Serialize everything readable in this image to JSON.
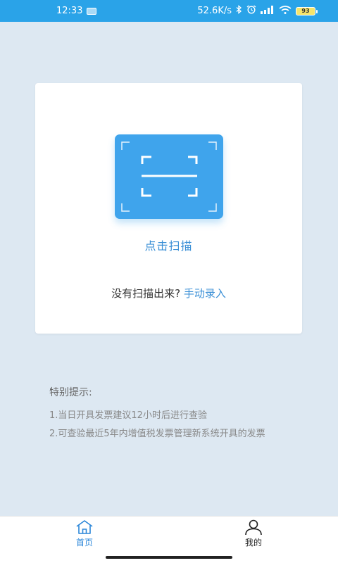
{
  "status_bar": {
    "time": "12:33",
    "network_speed": "52.6K/s",
    "battery_level": "93",
    "icons": [
      "notification-icon",
      "bluetooth-icon",
      "alarm-icon",
      "signal-icon",
      "wifi-icon",
      "battery-icon"
    ]
  },
  "scan_card": {
    "scan_label": "点击扫描",
    "manual_prompt": "没有扫描出来?",
    "manual_link": "手动录入",
    "scan_icon": "scan-frame-icon"
  },
  "tips": {
    "title": "特别提示:",
    "items": [
      "1.当日开具发票建议12小时后进行查验",
      "2.可查验最近5年内增值税发票管理新系统开具的发票"
    ]
  },
  "bottom_nav": {
    "items": [
      {
        "label": "首页",
        "icon": "home-icon",
        "active": true
      },
      {
        "label": "我的",
        "icon": "user-icon",
        "active": false
      }
    ]
  },
  "colors": {
    "status_bar": "#2aa3e8",
    "accent": "#3fa4ec",
    "link": "#3a8fd6",
    "background": "#dde8f2"
  }
}
